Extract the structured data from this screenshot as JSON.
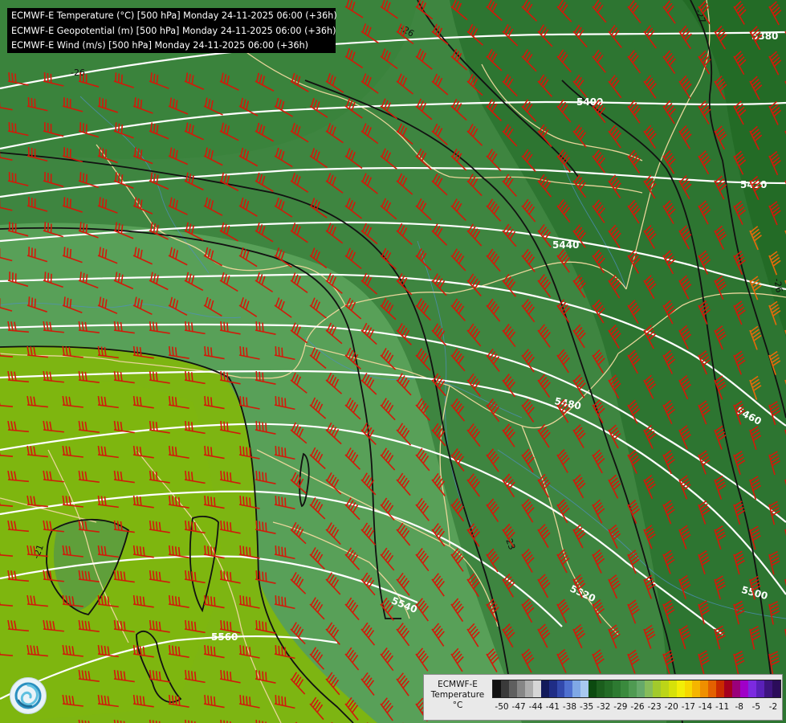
{
  "header": {
    "lines": [
      "ECMWF-E Temperature (°C) [500 hPa] Monday 24-11-2025 06:00 (+36h)",
      "ECMWF-E Geopotential (m) [500 hPa] Monday 24-11-2025 06:00 (+36h)",
      "ECMWF-E Wind (m/s) [500 hPa] Monday 24-11-2025 06:00 (+36h)"
    ]
  },
  "geopotential_labels": [
    "5380",
    "5400",
    "5420",
    "5440",
    "5460",
    "5480",
    "5500",
    "5520",
    "5540",
    "5560"
  ],
  "temperature_labels": [
    "-27",
    "-26",
    "-26",
    "-26",
    "-23",
    "-21"
  ],
  "legend": {
    "title_lines": [
      "ECMWF-E",
      "Temperature",
      "°C"
    ],
    "ticks": [
      "-50",
      "-47",
      "-44",
      "-41",
      "-38",
      "-35",
      "-32",
      "-29",
      "-26",
      "-23",
      "-20",
      "-17",
      "-14",
      "-11",
      "-8",
      "-5",
      "-2"
    ],
    "colors": [
      "#111111",
      "#3a3a3a",
      "#5f5f5f",
      "#868686",
      "#adadad",
      "#d6d6d6",
      "#121a5a",
      "#1f2d86",
      "#3249ad",
      "#4f70d0",
      "#7fa8e6",
      "#a8c9f0",
      "#0c4a10",
      "#1b5e1d",
      "#236b26",
      "#2d7a31",
      "#3a8a3d",
      "#4f9a52",
      "#66a96a",
      "#86bc5a",
      "#a2ca2c",
      "#bcd518",
      "#d6e10a",
      "#f2ee07",
      "#f7d800",
      "#f5b500",
      "#ef8f00",
      "#e36100",
      "#c92b00",
      "#a5001e",
      "#9a007a",
      "#a000c8",
      "#7c2ae0",
      "#5a20b8",
      "#3e147f",
      "#2b0c5a"
    ]
  },
  "colors": {
    "geopotential_contour": "#ffffff",
    "temperature_contour": "#111111",
    "borders": "#e8d59a",
    "rivers": "#4f8fc0",
    "wind_barbs": "#d11a0a",
    "wind_barbs_strong": "#e8690a"
  },
  "icons": {
    "logo": "swirl-logo-icon"
  }
}
